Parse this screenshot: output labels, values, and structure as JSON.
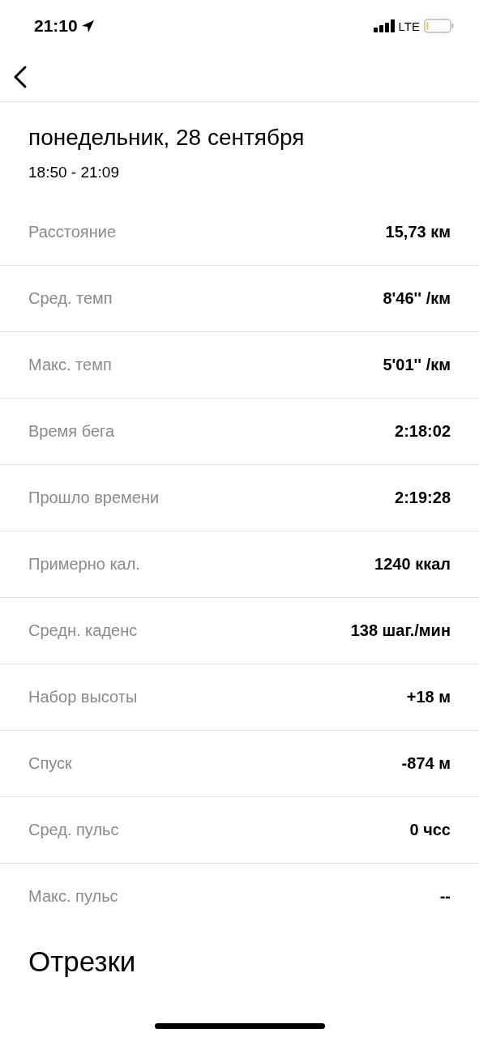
{
  "status_bar": {
    "time": "21:10",
    "network": "LTE"
  },
  "header": {
    "title": "понедельник, 28 сентября",
    "time_range": "18:50 - 21:09"
  },
  "stats": [
    {
      "label": "Расстояние",
      "value": "15,73 км"
    },
    {
      "label": "Сред. темп",
      "value": "8'46'' /км"
    },
    {
      "label": "Макс. темп",
      "value": "5'01'' /км"
    },
    {
      "label": "Время бега",
      "value": "2:18:02"
    },
    {
      "label": "Прошло времени",
      "value": "2:19:28"
    },
    {
      "label": "Примерно кал.",
      "value": "1240 ккал"
    },
    {
      "label": "Средн. каденс",
      "value": "138 шаг./мин"
    },
    {
      "label": "Набор высоты",
      "value": "+18 м"
    },
    {
      "label": "Спуск",
      "value": "-874 м"
    },
    {
      "label": "Сред. пульс",
      "value": "0 чсс"
    },
    {
      "label": "Макс. пульс",
      "value": "--"
    }
  ],
  "section_title": "Отрезки"
}
